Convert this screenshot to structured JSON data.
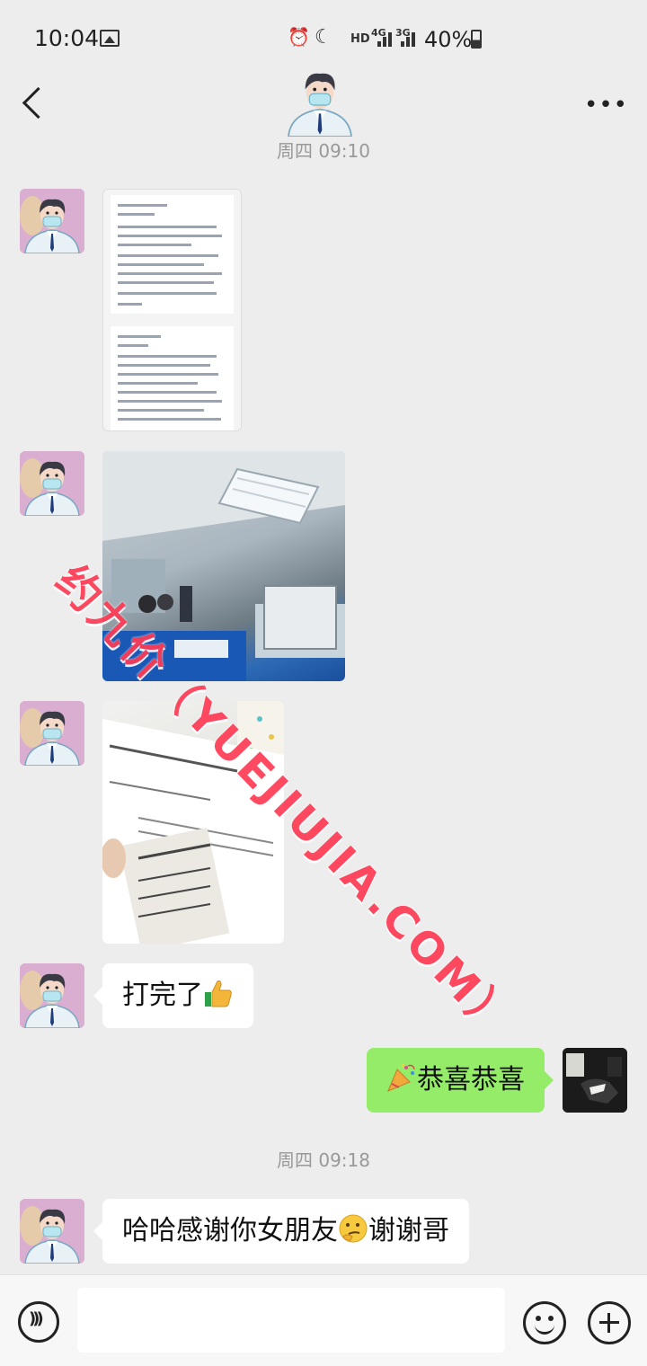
{
  "status_bar": {
    "time": "10:04",
    "network_label": "HD",
    "sim1": "4G",
    "sim2": "3G",
    "battery": "40%",
    "icons": [
      "gallery-icon",
      "alarm-icon",
      "do-not-disturb-moon-icon",
      "signal-icon",
      "battery-icon"
    ]
  },
  "header": {
    "back_icon": "back-chevron-icon",
    "avatar": "doctor-avatar",
    "more_label": "•••"
  },
  "timestamps": {
    "first": "周四 09:10",
    "second": "周四 09:18"
  },
  "messages": {
    "doc_screenshot": {
      "type": "image",
      "sender": "other",
      "content": "screenshot-of-appointment-text"
    },
    "clinic_photo": {
      "type": "image",
      "sender": "other",
      "content": "clinic-waiting-room-photo"
    },
    "receipt_photo": {
      "type": "image",
      "sender": "other",
      "content": "vaccination-receipt-photo"
    },
    "done": {
      "text": "打完了",
      "emoji": "thumbs-up-icon",
      "sender": "other"
    },
    "congrats": {
      "text": "恭喜恭喜",
      "emoji": "party-popper-icon",
      "sender": "me"
    },
    "thanks": {
      "text_before": "哈哈感谢你女朋友",
      "emoji": "thinking-face-icon",
      "text_after": "谢谢哥",
      "sender": "other"
    }
  },
  "watermark": "约九价（YUEJIUJIA.COM）",
  "input_bar": {
    "voice_icon": "voice-icon",
    "text_value": "",
    "emoji_icon": "smiley-icon",
    "plus_icon": "plus-icon"
  },
  "colors": {
    "background": "#ededed",
    "outgoing_bubble": "#95ec69",
    "incoming_bubble": "#ffffff",
    "watermark": "#ff3b55"
  }
}
